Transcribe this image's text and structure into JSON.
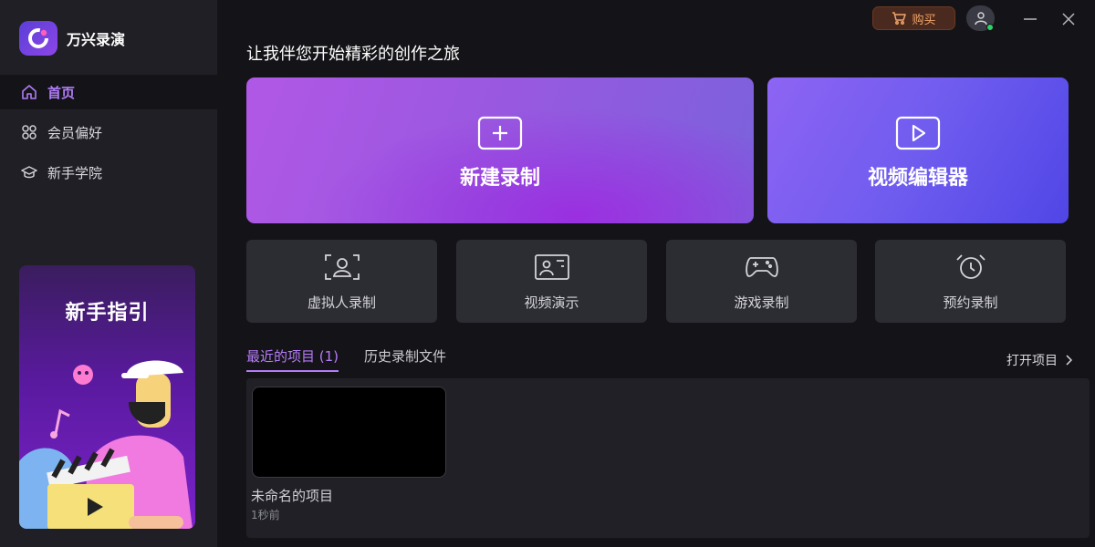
{
  "app": {
    "name": "万兴录演"
  },
  "sidebar": {
    "items": [
      {
        "label": "首页",
        "icon": "home-icon",
        "active": true
      },
      {
        "label": "会员偏好",
        "icon": "grid-icon",
        "active": false
      },
      {
        "label": "新手学院",
        "icon": "graduation-cap-icon",
        "active": false
      }
    ],
    "promo": {
      "title": "新手指引"
    }
  },
  "topbar": {
    "buy_label": "购买"
  },
  "main": {
    "greeting": "让我伴您开始精彩的创作之旅",
    "big_cards": [
      {
        "label": "新建录制",
        "icon": "plus-icon"
      },
      {
        "label": "视频编辑器",
        "icon": "play-icon"
      }
    ],
    "small_cards": [
      {
        "label": "虚拟人录制",
        "icon": "avatar-frame-icon"
      },
      {
        "label": "视频演示",
        "icon": "presentation-icon"
      },
      {
        "label": "游戏录制",
        "icon": "gamepad-icon"
      },
      {
        "label": "预约录制",
        "icon": "alarm-clock-icon"
      }
    ],
    "tabs": [
      {
        "label": "最近的项目 (1)",
        "active": true
      },
      {
        "label": "历史录制文件",
        "active": false
      }
    ],
    "open_project_label": "打开项目",
    "projects": [
      {
        "name": "未命名的项目",
        "time": "1秒前"
      }
    ]
  },
  "colors": {
    "accent": "#b57cf8",
    "buy_text": "#f0a46a",
    "online": "#2fd16a"
  }
}
